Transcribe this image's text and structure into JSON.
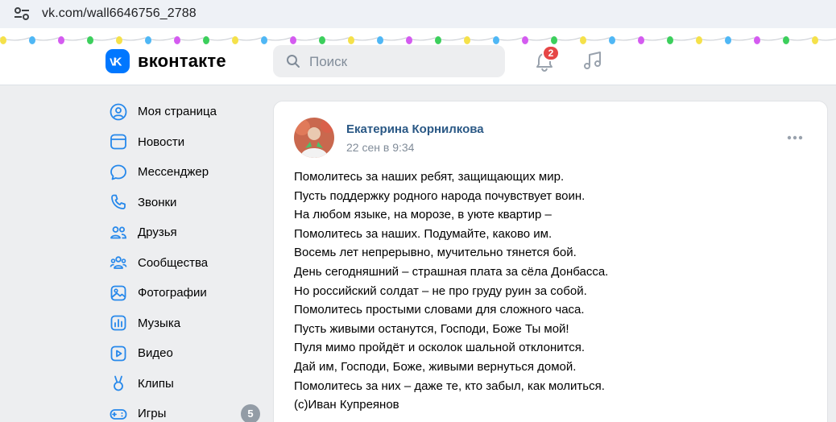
{
  "browser": {
    "url": "vk.com/wall6646756_2788",
    "site_info_icon": "tune-icon"
  },
  "header": {
    "logo_text": "вконтакте",
    "search_placeholder": "Поиск",
    "notifications_count": "2",
    "icons": [
      "vk-logo-icon",
      "search-icon",
      "bell-icon",
      "music-icon"
    ],
    "garland_colors": [
      "#f5e14a",
      "#4fb7f5",
      "#d45bf0",
      "#3ccf5c"
    ]
  },
  "sidebar": {
    "items": [
      {
        "label": "Моя страница",
        "icon": "user-circle-icon"
      },
      {
        "label": "Новости",
        "icon": "newsfeed-icon"
      },
      {
        "label": "Мессенджер",
        "icon": "message-icon"
      },
      {
        "label": "Звонки",
        "icon": "phone-icon"
      },
      {
        "label": "Друзья",
        "icon": "friends-icon"
      },
      {
        "label": "Сообщества",
        "icon": "communities-icon"
      },
      {
        "label": "Фотографии",
        "icon": "photos-icon"
      },
      {
        "label": "Музыка",
        "icon": "music-icon"
      },
      {
        "label": "Видео",
        "icon": "video-icon"
      },
      {
        "label": "Клипы",
        "icon": "clips-icon"
      },
      {
        "label": "Игры",
        "icon": "games-icon",
        "count": "5"
      }
    ]
  },
  "post": {
    "author": "Екатерина Корнилкова",
    "date": "22 сен в 9:34",
    "lines": [
      "Помолитесь за наших ребят, защищающих мир.",
      "Пусть поддержку родного народа почувствует воин.",
      "На любом языке, на морозе, в уюте квартир –",
      "Помолитесь за наших. Подумайте, каково им.",
      "Восемь лет непрерывно, мучительно тянется бой.",
      "День сегодняшний – страшная плата за сёла Донбасса.",
      "Но российский солдат – не про груду руин за собой.",
      "Помолитесь простыми словами для сложного часа.",
      "Пусть живыми останутся, Господи, Боже Ты мой!",
      "Пуля мимо пройдёт и осколок шальной отклонится.",
      "Дай им, Господи, Боже, живыми вернуться домой.",
      "Помолитесь за них – даже те, кто забыл, как молиться.",
      "(с)Иван Купреянов"
    ]
  },
  "colors": {
    "brand": "#0077ff",
    "link": "#2a5885",
    "badge": "#e64646",
    "muted": "#818c99",
    "page_bg": "#edeef0"
  }
}
